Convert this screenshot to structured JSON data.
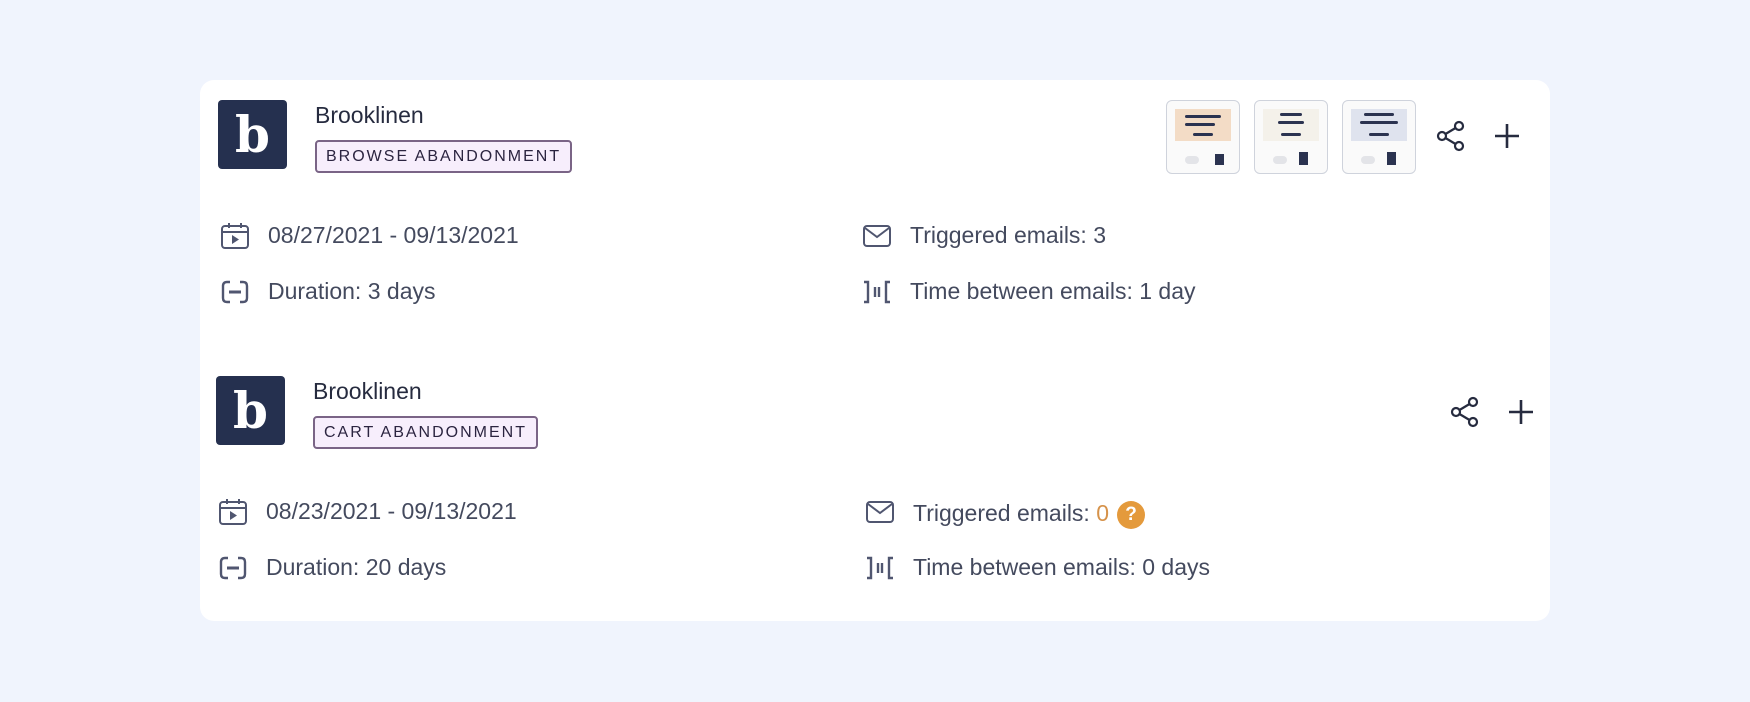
{
  "campaigns": [
    {
      "brand": "Brooklinen",
      "logo_letter": "b",
      "tag": "BROWSE ABANDONMENT",
      "date_range": "08/27/2021 - 09/13/2021",
      "triggered_label": "Triggered emails: ",
      "triggered_value": "3",
      "duration": "Duration: 3 days",
      "time_between": "Time between emails: 1 day",
      "thumbnails": [
        "email-preview-1",
        "email-preview-2",
        "email-preview-3"
      ]
    },
    {
      "brand": "Brooklinen",
      "logo_letter": "b",
      "tag": "CART ABANDONMENT",
      "date_range": "08/23/2021 - 09/13/2021",
      "triggered_label": "Triggered emails: ",
      "triggered_value": "0",
      "triggered_help": "?",
      "duration": "Duration: 20 days",
      "time_between": "Time between emails: 0 days"
    }
  ],
  "icons": {
    "share": "share-icon",
    "add": "plus-icon",
    "calendar": "calendar-play-icon",
    "mail": "mail-icon",
    "duration": "duration-icon",
    "interval": "interval-icon",
    "help": "help-icon"
  },
  "colors": {
    "logo_bg": "#25304f",
    "tag_bg": "#f7eefc",
    "tag_border": "#7a6486",
    "warning": "#e49a3c",
    "page_bg": "#f0f4fd"
  }
}
